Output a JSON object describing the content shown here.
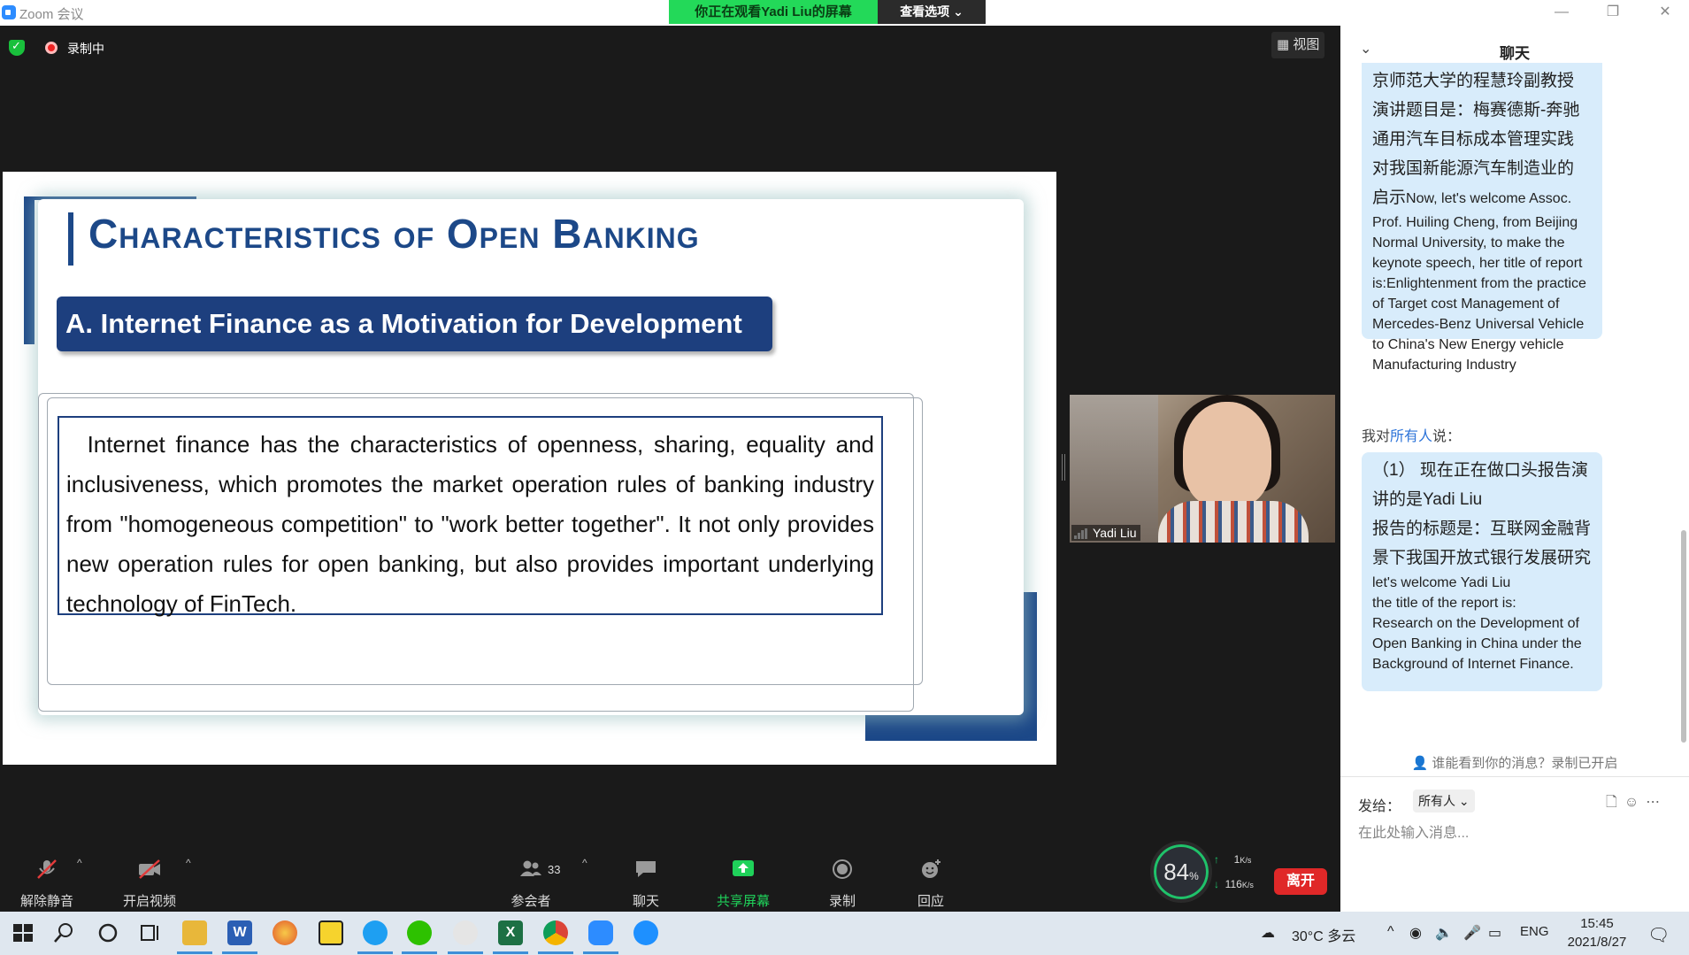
{
  "window": {
    "title": "Zoom 会议",
    "viewing_banner": "你正在观看Yadi Liu的屏幕",
    "view_options": "查看选项 ⌄",
    "minimize": "—",
    "restore": "❐",
    "close": "✕"
  },
  "meeting": {
    "recording_label": "录制中",
    "view_button": "▦ 视图"
  },
  "slide": {
    "title": "Characteristics of Open Banking",
    "subtitle": "A. Internet Finance as a Motivation for Development",
    "body": "  Internet finance has the characteristics of openness, sharing, equality and inclusiveness, which promotes the market operation rules of banking industry from \"homogeneous competition\" to \"work better together\". It not only provides new operation rules for open banking, but also provides important underlying technology of FinTech."
  },
  "video": {
    "participant_name": "Yadi Liu"
  },
  "toolbar": {
    "unmute": "解除静音",
    "start_video": "开启视频",
    "participants": "参会者",
    "participant_count": "33",
    "chat": "聊天",
    "share_screen": "共享屏幕",
    "record": "录制",
    "reactions": "回应",
    "leave": "离开"
  },
  "network": {
    "cpu_percent": "84",
    "cpu_unit": "%",
    "upload": "1",
    "download": "116",
    "unit": "K/s"
  },
  "chat": {
    "title": "聊天",
    "messages": [
      {
        "zh": "京师范大学的程慧玲副教授\n演讲题目是：梅赛德斯-奔驰\n通用汽车目标成本管理实践\n对我国新能源汽车制造业的\n启示",
        "en_inline": "Now, let's welcome Assoc.",
        "en": "Prof. Huiling Cheng, from Beijing Normal University, to make the keynote speech, her title of report is:Enlightenment from the practice of Target cost Management of Mercedes-Benz Universal Vehicle to China's New Energy vehicle Manufacturing Industry"
      },
      {
        "zh": "（1）  现在正在做口头报告演讲的是Yadi Liu\n报告的标题是：互联网金融背景下我国开放式银行发展研究",
        "en": "let's welcome Yadi Liu\nthe title of the report is:\nResearch on the Development of Open Banking in China under the Background of Internet Finance."
      }
    ],
    "to_prefix": "我对",
    "to_target": "所有人",
    "to_suffix": "说：",
    "visibility_hint": "谁能看到你的消息？录制已开启",
    "send_to_label": "发给：",
    "send_to_value": "所有人 ⌄",
    "input_placeholder": "在此处输入消息..."
  },
  "taskbar": {
    "weather": "30°C  多云",
    "lang": "ENG",
    "time": "15:45",
    "date": "2021/8/27"
  }
}
